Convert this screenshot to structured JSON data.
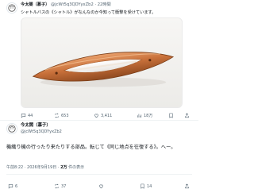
{
  "post1": {
    "author_name": "今太閤（慕子）",
    "handle": "@jcWt5q3QDYyxZb2",
    "separator": "·",
    "time_ago": "22時間",
    "text": "シャトルバスの《シャトル》がなんなのか今知って衝撃を受けています。",
    "image_alt": "shuttle",
    "stats": {
      "replies": "44",
      "reposts": "653",
      "likes": "3,411",
      "views": "18万"
    }
  },
  "post2": {
    "author_name": "今太閤（慕子）",
    "handle": "@jcWt5q3QDYyxZb2",
    "text": "機織り機の行ったり来たりする部品。転じて《同じ地点を往復する》。へー。",
    "time": "午前8:22",
    "date": "2026年9月19日",
    "views_count": "2万",
    "views_label": "件の表示",
    "stats": {
      "replies": "6",
      "reposts": "37",
      "likes": "14"
    }
  },
  "colors": {
    "text_primary": "#0f1419",
    "text_secondary": "#536471",
    "divider": "#eff3f4",
    "shuttle_wood": "#c8703a"
  }
}
